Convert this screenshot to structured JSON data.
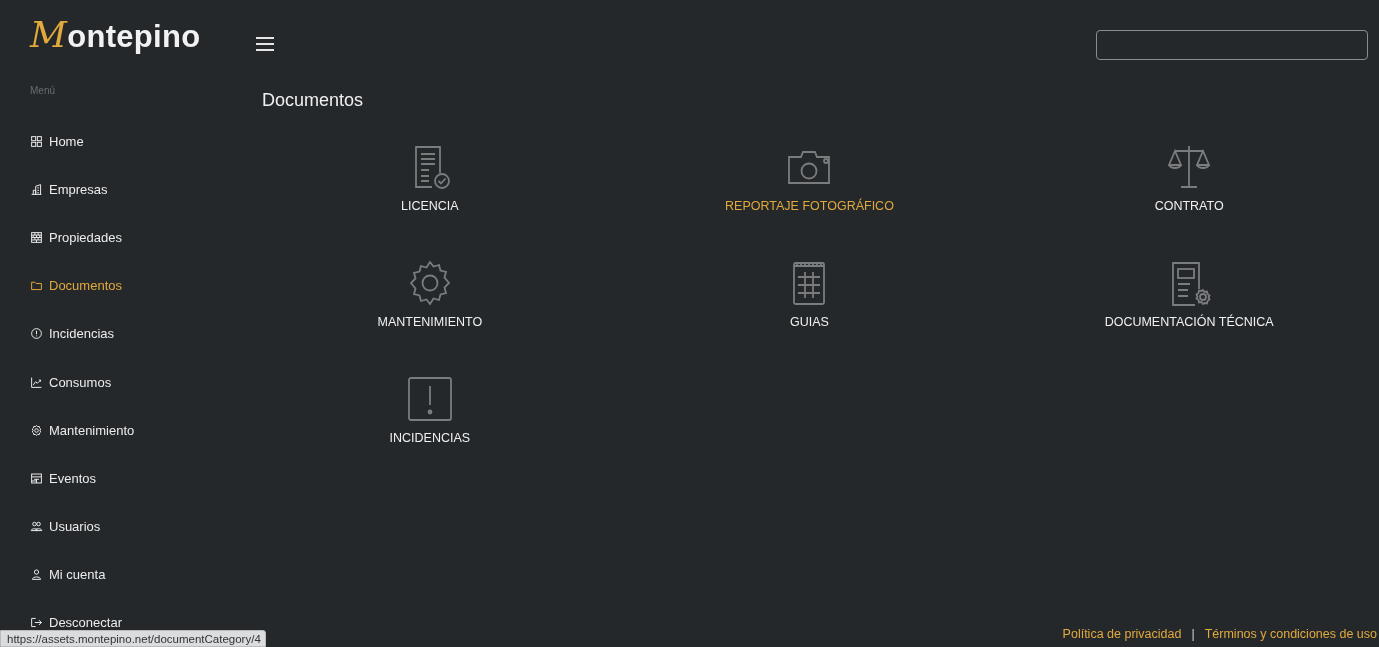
{
  "logo": "Montepino",
  "sidebar": {
    "heading": "Menú",
    "items": [
      {
        "label": "Home",
        "kind": "grid",
        "selected": false
      },
      {
        "label": "Empresas",
        "kind": "building",
        "selected": false
      },
      {
        "label": "Propiedades",
        "kind": "bricks",
        "selected": false
      },
      {
        "label": "Documentos",
        "kind": "folder",
        "selected": true
      },
      {
        "label": "Incidencias",
        "kind": "alert",
        "selected": false
      },
      {
        "label": "Consumos",
        "kind": "chart",
        "selected": false
      },
      {
        "label": "Mantenimiento",
        "kind": "gear",
        "selected": false
      },
      {
        "label": "Eventos",
        "kind": "calendar",
        "selected": false
      },
      {
        "label": "Usuarios",
        "kind": "users",
        "selected": false
      },
      {
        "label": "Mi cuenta",
        "kind": "user",
        "selected": false
      },
      {
        "label": "Desconectar",
        "kind": "logout",
        "selected": false
      }
    ]
  },
  "page_title": "Documentos",
  "categories": [
    {
      "label": "LICENCIA",
      "kind": "doc-check",
      "highlighted": false
    },
    {
      "label": "REPORTAJE FOTOGRÁFICO",
      "kind": "camera",
      "highlighted": true
    },
    {
      "label": "CONTRATO",
      "kind": "scale",
      "highlighted": false
    },
    {
      "label": "MANTENIMIENTO",
      "kind": "gear",
      "highlighted": false
    },
    {
      "label": "GUIAS",
      "kind": "notepad",
      "highlighted": false
    },
    {
      "label": "DOCUMENTACIÓN TÉCNICA",
      "kind": "doc-gear",
      "highlighted": false
    },
    {
      "label": "INCIDENCIAS",
      "kind": "alert-square",
      "highlighted": false
    }
  ],
  "footer_links": [
    "Política de privacidad",
    "Términos y condiciones de uso"
  ],
  "footer_separator": "|",
  "status_url": "https://assets.montepino.net/documentCategory/4"
}
